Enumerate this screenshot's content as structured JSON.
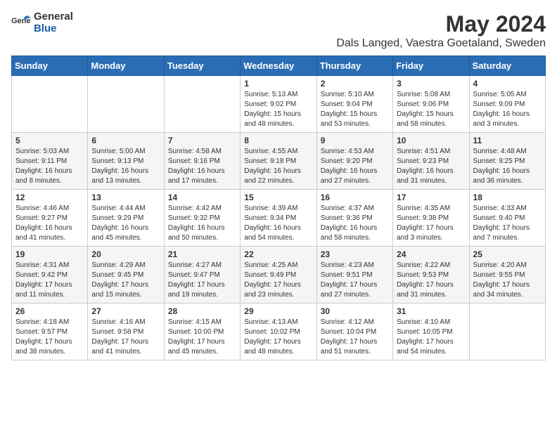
{
  "header": {
    "logo_general": "General",
    "logo_blue": "Blue",
    "month_title": "May 2024",
    "location": "Dals Langed, Vaestra Goetaland, Sweden"
  },
  "weekdays": [
    "Sunday",
    "Monday",
    "Tuesday",
    "Wednesday",
    "Thursday",
    "Friday",
    "Saturday"
  ],
  "weeks": [
    [
      {
        "day": "",
        "sunrise": "",
        "sunset": "",
        "daylight": ""
      },
      {
        "day": "",
        "sunrise": "",
        "sunset": "",
        "daylight": ""
      },
      {
        "day": "",
        "sunrise": "",
        "sunset": "",
        "daylight": ""
      },
      {
        "day": "1",
        "sunrise": "Sunrise: 5:13 AM",
        "sunset": "Sunset: 9:02 PM",
        "daylight": "Daylight: 15 hours and 48 minutes."
      },
      {
        "day": "2",
        "sunrise": "Sunrise: 5:10 AM",
        "sunset": "Sunset: 9:04 PM",
        "daylight": "Daylight: 15 hours and 53 minutes."
      },
      {
        "day": "3",
        "sunrise": "Sunrise: 5:08 AM",
        "sunset": "Sunset: 9:06 PM",
        "daylight": "Daylight: 15 hours and 58 minutes."
      },
      {
        "day": "4",
        "sunrise": "Sunrise: 5:05 AM",
        "sunset": "Sunset: 9:09 PM",
        "daylight": "Daylight: 16 hours and 3 minutes."
      }
    ],
    [
      {
        "day": "5",
        "sunrise": "Sunrise: 5:03 AM",
        "sunset": "Sunset: 9:11 PM",
        "daylight": "Daylight: 16 hours and 8 minutes."
      },
      {
        "day": "6",
        "sunrise": "Sunrise: 5:00 AM",
        "sunset": "Sunset: 9:13 PM",
        "daylight": "Daylight: 16 hours and 13 minutes."
      },
      {
        "day": "7",
        "sunrise": "Sunrise: 4:58 AM",
        "sunset": "Sunset: 9:16 PM",
        "daylight": "Daylight: 16 hours and 17 minutes."
      },
      {
        "day": "8",
        "sunrise": "Sunrise: 4:55 AM",
        "sunset": "Sunset: 9:18 PM",
        "daylight": "Daylight: 16 hours and 22 minutes."
      },
      {
        "day": "9",
        "sunrise": "Sunrise: 4:53 AM",
        "sunset": "Sunset: 9:20 PM",
        "daylight": "Daylight: 16 hours and 27 minutes."
      },
      {
        "day": "10",
        "sunrise": "Sunrise: 4:51 AM",
        "sunset": "Sunset: 9:23 PM",
        "daylight": "Daylight: 16 hours and 31 minutes."
      },
      {
        "day": "11",
        "sunrise": "Sunrise: 4:48 AM",
        "sunset": "Sunset: 9:25 PM",
        "daylight": "Daylight: 16 hours and 36 minutes."
      }
    ],
    [
      {
        "day": "12",
        "sunrise": "Sunrise: 4:46 AM",
        "sunset": "Sunset: 9:27 PM",
        "daylight": "Daylight: 16 hours and 41 minutes."
      },
      {
        "day": "13",
        "sunrise": "Sunrise: 4:44 AM",
        "sunset": "Sunset: 9:29 PM",
        "daylight": "Daylight: 16 hours and 45 minutes."
      },
      {
        "day": "14",
        "sunrise": "Sunrise: 4:42 AM",
        "sunset": "Sunset: 9:32 PM",
        "daylight": "Daylight: 16 hours and 50 minutes."
      },
      {
        "day": "15",
        "sunrise": "Sunrise: 4:39 AM",
        "sunset": "Sunset: 9:34 PM",
        "daylight": "Daylight: 16 hours and 54 minutes."
      },
      {
        "day": "16",
        "sunrise": "Sunrise: 4:37 AM",
        "sunset": "Sunset: 9:36 PM",
        "daylight": "Daylight: 16 hours and 58 minutes."
      },
      {
        "day": "17",
        "sunrise": "Sunrise: 4:35 AM",
        "sunset": "Sunset: 9:38 PM",
        "daylight": "Daylight: 17 hours and 3 minutes."
      },
      {
        "day": "18",
        "sunrise": "Sunrise: 4:33 AM",
        "sunset": "Sunset: 9:40 PM",
        "daylight": "Daylight: 17 hours and 7 minutes."
      }
    ],
    [
      {
        "day": "19",
        "sunrise": "Sunrise: 4:31 AM",
        "sunset": "Sunset: 9:42 PM",
        "daylight": "Daylight: 17 hours and 11 minutes."
      },
      {
        "day": "20",
        "sunrise": "Sunrise: 4:29 AM",
        "sunset": "Sunset: 9:45 PM",
        "daylight": "Daylight: 17 hours and 15 minutes."
      },
      {
        "day": "21",
        "sunrise": "Sunrise: 4:27 AM",
        "sunset": "Sunset: 9:47 PM",
        "daylight": "Daylight: 17 hours and 19 minutes."
      },
      {
        "day": "22",
        "sunrise": "Sunrise: 4:25 AM",
        "sunset": "Sunset: 9:49 PM",
        "daylight": "Daylight: 17 hours and 23 minutes."
      },
      {
        "day": "23",
        "sunrise": "Sunrise: 4:23 AM",
        "sunset": "Sunset: 9:51 PM",
        "daylight": "Daylight: 17 hours and 27 minutes."
      },
      {
        "day": "24",
        "sunrise": "Sunrise: 4:22 AM",
        "sunset": "Sunset: 9:53 PM",
        "daylight": "Daylight: 17 hours and 31 minutes."
      },
      {
        "day": "25",
        "sunrise": "Sunrise: 4:20 AM",
        "sunset": "Sunset: 9:55 PM",
        "daylight": "Daylight: 17 hours and 34 minutes."
      }
    ],
    [
      {
        "day": "26",
        "sunrise": "Sunrise: 4:18 AM",
        "sunset": "Sunset: 9:57 PM",
        "daylight": "Daylight: 17 hours and 38 minutes."
      },
      {
        "day": "27",
        "sunrise": "Sunrise: 4:16 AM",
        "sunset": "Sunset: 9:58 PM",
        "daylight": "Daylight: 17 hours and 41 minutes."
      },
      {
        "day": "28",
        "sunrise": "Sunrise: 4:15 AM",
        "sunset": "Sunset: 10:00 PM",
        "daylight": "Daylight: 17 hours and 45 minutes."
      },
      {
        "day": "29",
        "sunrise": "Sunrise: 4:13 AM",
        "sunset": "Sunset: 10:02 PM",
        "daylight": "Daylight: 17 hours and 48 minutes."
      },
      {
        "day": "30",
        "sunrise": "Sunrise: 4:12 AM",
        "sunset": "Sunset: 10:04 PM",
        "daylight": "Daylight: 17 hours and 51 minutes."
      },
      {
        "day": "31",
        "sunrise": "Sunrise: 4:10 AM",
        "sunset": "Sunset: 10:05 PM",
        "daylight": "Daylight: 17 hours and 54 minutes."
      },
      {
        "day": "",
        "sunrise": "",
        "sunset": "",
        "daylight": ""
      }
    ]
  ]
}
